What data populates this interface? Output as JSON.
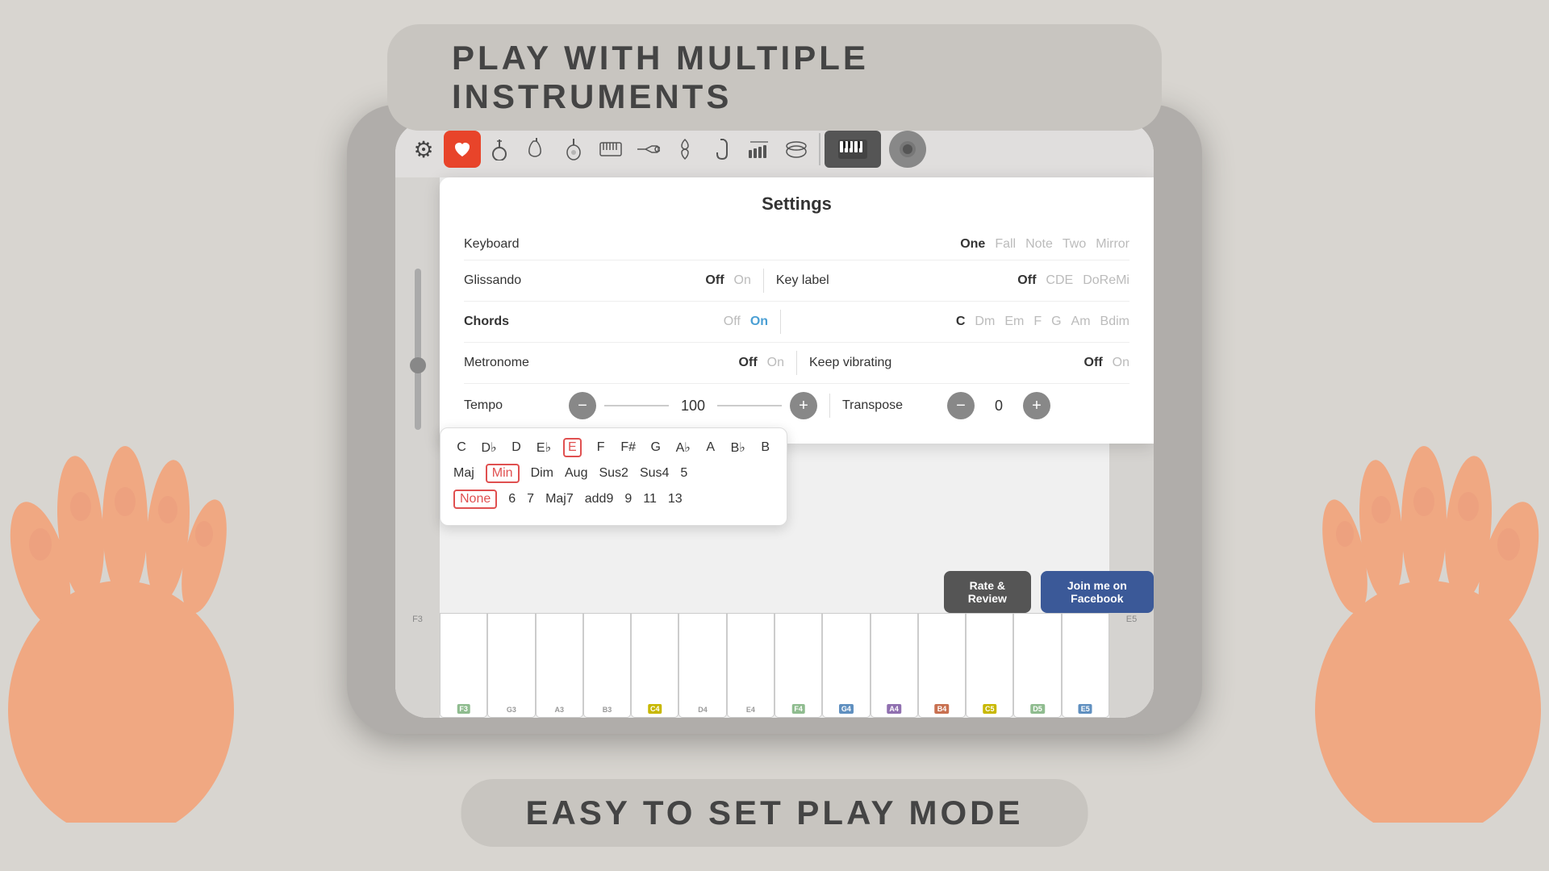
{
  "top_banner": {
    "text": "PLAY WITH MULTIPLE INSTRUMENTS"
  },
  "bottom_banner": {
    "text": "EASY TO SET PLAY MODE"
  },
  "toolbar": {
    "gear_icon": "⚙",
    "instruments": [
      {
        "name": "heart-music",
        "icon": "♥",
        "active": true
      },
      {
        "name": "banjo",
        "icon": "𝄞",
        "active": false
      },
      {
        "name": "electric-guitar",
        "icon": "🎸",
        "active": false
      },
      {
        "name": "acoustic-guitar",
        "icon": "🎸",
        "active": false
      },
      {
        "name": "keyboard",
        "icon": "🎹",
        "active": false
      },
      {
        "name": "trumpet",
        "icon": "🎺",
        "active": false
      },
      {
        "name": "violin",
        "icon": "🎻",
        "active": false
      },
      {
        "name": "saxophone",
        "icon": "🎷",
        "active": false
      },
      {
        "name": "xylophone",
        "icon": "🎵",
        "active": false
      },
      {
        "name": "drums",
        "icon": "🥁",
        "active": false
      }
    ],
    "piano_icon": "🎹",
    "record_icon": "⏺"
  },
  "settings": {
    "title": "Settings",
    "keyboard": {
      "label": "Keyboard",
      "options": [
        "One",
        "Fall",
        "Note",
        "Two",
        "Mirror"
      ],
      "active": "One"
    },
    "glissando": {
      "label": "Glissando",
      "options": [
        "Off",
        "On"
      ],
      "active": "Off",
      "key_label": {
        "label": "Key label",
        "options": [
          "Off",
          "CDE",
          "DoReMi"
        ],
        "active": "Off"
      }
    },
    "chords": {
      "label": "Chords",
      "options": [
        "Off",
        "On"
      ],
      "active": "On",
      "chord_options": [
        "C",
        "Dm",
        "Em",
        "F",
        "G",
        "Am",
        "Bdim"
      ]
    },
    "metronome": {
      "label": "Metronome",
      "options": [
        "Off",
        "On"
      ],
      "active": "Off",
      "keep_vibrating": {
        "label": "Keep vibrating",
        "options": [
          "Off",
          "On"
        ],
        "active": "Off"
      }
    },
    "tempo": {
      "label": "Tempo",
      "value": "100",
      "minus": "−",
      "plus": "+"
    },
    "transpose": {
      "label": "Transpose",
      "value": "0",
      "minus": "−",
      "plus": "+"
    }
  },
  "chord_popup": {
    "notes": [
      "C",
      "D♭",
      "D",
      "E♭",
      "E",
      "F",
      "F#",
      "G",
      "A♭",
      "A",
      "B♭",
      "B"
    ],
    "selected_note": "E",
    "types_row1": [
      "Maj",
      "Min",
      "Dim",
      "Aug",
      "Sus2",
      "Sus4",
      "5"
    ],
    "selected_type": "Min",
    "types_row2": [
      "None",
      "6",
      "7",
      "Maj7",
      "add9",
      "9",
      "11",
      "13"
    ],
    "selected_type2": "None"
  },
  "action_buttons": {
    "review_label": "Rate & Review",
    "facebook_label": "Join me on Facebook"
  },
  "piano_labels": {
    "keys": [
      "F3",
      "G3",
      "A3",
      "B3",
      "C4",
      "D4",
      "E4",
      "F4",
      "G4",
      "A4",
      "B4",
      "C5",
      "D5",
      "E5"
    ]
  }
}
